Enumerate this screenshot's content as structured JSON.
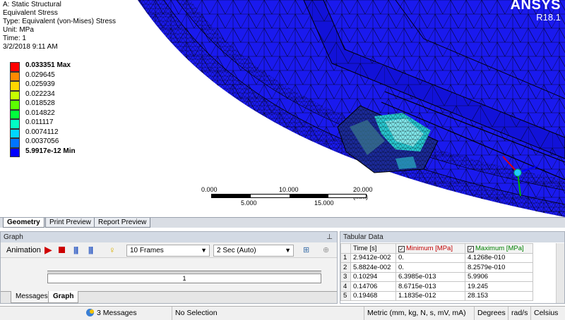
{
  "model": {
    "title": "A: Static Structural",
    "result_name": "Equivalent Stress",
    "type_line": "Type: Equivalent (von-Mises) Stress",
    "unit_line": "Unit: MPa",
    "time_line": "Time: 1",
    "date_line": "3/2/2018 9:11 AM"
  },
  "legend": {
    "entries": [
      {
        "label": "0.033351 Max",
        "color": "#ff0000",
        "bold": true
      },
      {
        "label": "0.029645",
        "color": "#ff8a00",
        "bold": false
      },
      {
        "label": "0.025939",
        "color": "#ffd600",
        "bold": false
      },
      {
        "label": "0.022234",
        "color": "#c6ff00",
        "bold": false
      },
      {
        "label": "0.018528",
        "color": "#5cff00",
        "bold": false
      },
      {
        "label": "0.014822",
        "color": "#00ff3c",
        "bold": false
      },
      {
        "label": "0.011117",
        "color": "#00ffc4",
        "bold": false
      },
      {
        "label": "0.0074112",
        "color": "#00d6ff",
        "bold": false
      },
      {
        "label": "0.0037056",
        "color": "#0074ff",
        "bold": false
      },
      {
        "label": "5.9917e-12 Min",
        "color": "#0000ff",
        "bold": true
      }
    ]
  },
  "logo": {
    "brand": "ANSYS",
    "version": "R18.1"
  },
  "scale": {
    "top_labels": [
      "0.000",
      "10.000",
      "20.000 (mm)"
    ],
    "bottom_labels": [
      "5.000",
      "15.000"
    ]
  },
  "view_tabs": [
    "Geometry",
    "Print Preview",
    "Report Preview"
  ],
  "graph": {
    "title": "Graph",
    "animation_label": "Animation",
    "frames": "10 Frames",
    "duration": "2 Sec (Auto)",
    "progress_label": "1",
    "tabs": [
      "Messages",
      "Graph"
    ]
  },
  "tabular": {
    "title": "Tabular Data",
    "headers": [
      "Time [s]",
      "Minimum [MPa]",
      "Maximum [MPa]"
    ],
    "rows": [
      [
        "1",
        "2.9412e-002",
        "0.",
        "4.1268e-010"
      ],
      [
        "2",
        "5.8824e-002",
        "0.",
        "8.2579e-010"
      ],
      [
        "3",
        "0.10294",
        "6.3985e-013",
        "5.9906"
      ],
      [
        "4",
        "0.14706",
        "8.6715e-013",
        "19.245"
      ],
      [
        "5",
        "0.19468",
        "1.1835e-012",
        "28.153"
      ]
    ],
    "min_color": "#c00000",
    "max_color": "#008000"
  },
  "status": {
    "messages": "3 Messages",
    "selection": "No Selection",
    "units": "Metric (mm, kg, N, s, mV, mA)",
    "angle": "Degrees",
    "rate": "rad/s",
    "temp": "Celsius"
  }
}
